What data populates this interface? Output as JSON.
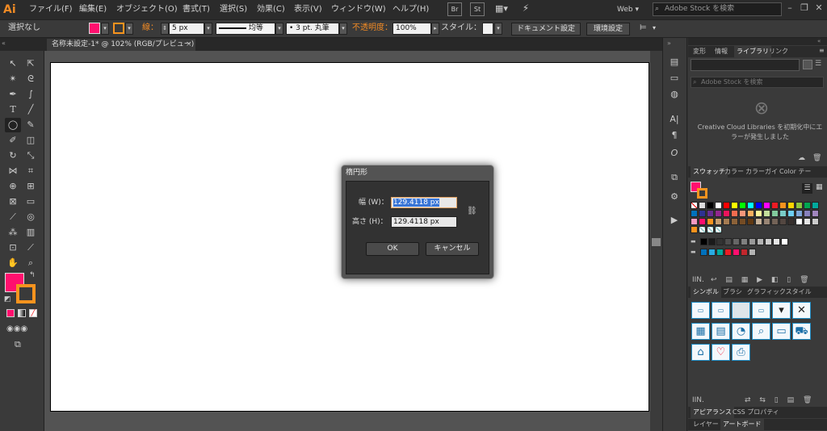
{
  "app": {
    "logo": "Ai"
  },
  "menu": {
    "items": [
      "ファイル(F)",
      "編集(E)",
      "オブジェクト(O)",
      "書式(T)",
      "選択(S)",
      "効果(C)",
      "表示(V)",
      "ウィンドウ(W)",
      "ヘルプ(H)"
    ],
    "icons": [
      "Br",
      "St"
    ],
    "workspace": "Web",
    "stock_search_placeholder": "Adobe Stock を検索"
  },
  "controlbar": {
    "selection": "選択なし",
    "stroke_label": "線：",
    "stroke_width": "5 px",
    "stroke_style": "均等",
    "brush": "3 pt. 丸筆",
    "opacity_label": "不透明度：",
    "opacity_value": "100%",
    "style_label": "スタイル：",
    "doc_settings": "ドキュメント設定",
    "prefs": "環境設定",
    "fill_color": "#ff0f6e",
    "stroke_color": "#f7931e"
  },
  "document": {
    "tab_title": "名称未設定-1* @ 102% (RGB/プレビュー)",
    "close": "×"
  },
  "dialog": {
    "title": "楕円形",
    "width_label": "幅 (W)：",
    "width_value": "129.4118 px",
    "height_label": "高さ (H)：",
    "height_value": "129.4118 px",
    "ok": "OK",
    "cancel": "キャンセル"
  },
  "panels": {
    "top_tabs": [
      "変形",
      "情報",
      "ライブラリ",
      "リンク"
    ],
    "library_search_placeholder": "Adobe Stock を検索",
    "library_error": "Creative Cloud Libraries を初期化中にエラーが発生しました",
    "swatch_tabs": [
      "スウォッチ",
      "カラー",
      "カラーガイ",
      "Color テー"
    ],
    "symbol_tabs": [
      "シンボル",
      "ブラシ",
      "グラフィックスタイル"
    ],
    "bottom_tabs_1": [
      "アピアランス",
      "CSS プロパティ"
    ],
    "bottom_tabs_2": [
      "レイヤー",
      "アートボード"
    ]
  }
}
